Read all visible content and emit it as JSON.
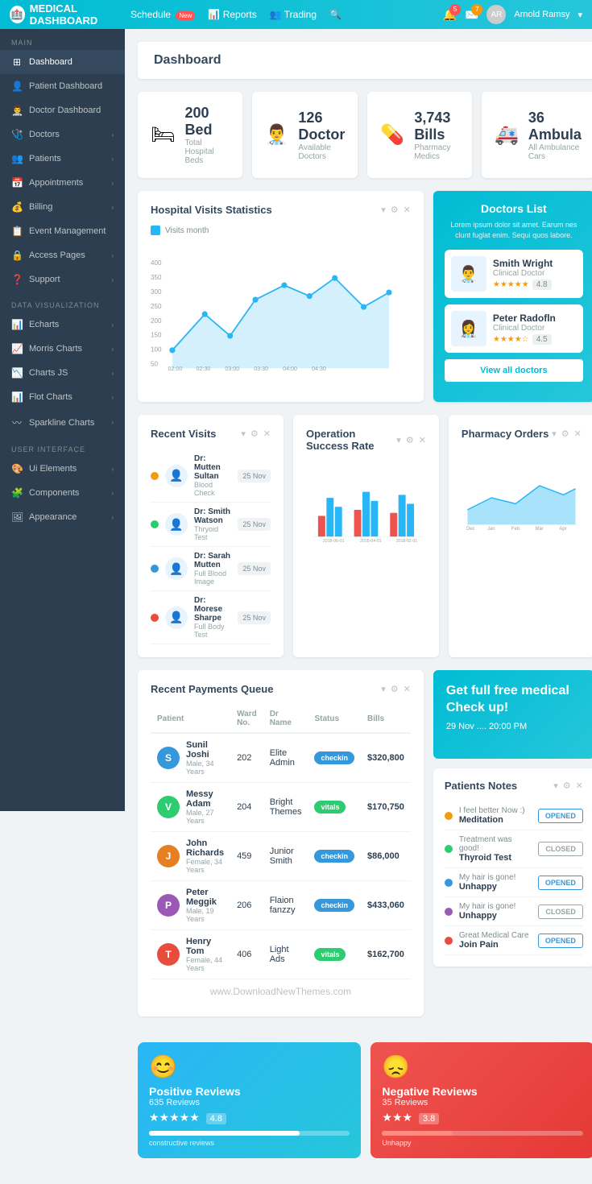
{
  "app": {
    "name": "MEDICAL DASHBOARD",
    "logo_icon": "🏥"
  },
  "topnav": {
    "schedule_label": "Schedule",
    "schedule_badge": "New",
    "reports_label": "Reports",
    "trading_label": "Trading",
    "notif_count": "5",
    "msg_count": "7",
    "user_name": "Arnold Ramsy"
  },
  "sidebar": {
    "main_title": "MAIN",
    "items_main": [
      {
        "label": "Dashboard",
        "icon": "⊞"
      },
      {
        "label": "Patient Dashboard",
        "icon": "👤"
      },
      {
        "label": "Doctor Dashboard",
        "icon": "👨‍⚕️"
      },
      {
        "label": "Doctors",
        "icon": "🩺",
        "has_arrow": true
      },
      {
        "label": "Patients",
        "icon": "👥",
        "has_arrow": true
      },
      {
        "label": "Appointments",
        "icon": "📅",
        "has_arrow": true
      },
      {
        "label": "Billing",
        "icon": "💰",
        "has_arrow": true
      },
      {
        "label": "Event Management",
        "icon": "📋"
      },
      {
        "label": "Access Pages",
        "icon": "🔒",
        "has_arrow": true
      },
      {
        "label": "Support",
        "icon": "❓",
        "has_arrow": true
      }
    ],
    "data_viz_title": "DATA VISUALIZATION",
    "items_data": [
      {
        "label": "Echarts",
        "icon": "📊",
        "has_arrow": true
      },
      {
        "label": "Morris Charts",
        "icon": "📈",
        "has_arrow": true
      },
      {
        "label": "Charts JS",
        "icon": "📉",
        "has_arrow": true
      },
      {
        "label": "Flot Charts",
        "icon": "📊",
        "has_arrow": true
      },
      {
        "label": "Sparkline Charts",
        "icon": "〰",
        "has_arrow": true
      }
    ],
    "ui_title": "USER INTERFACE",
    "items_ui": [
      {
        "label": "Ui Elements",
        "icon": "🎨",
        "has_arrow": true
      },
      {
        "label": "Components",
        "icon": "🧩",
        "has_arrow": true
      },
      {
        "label": "Appearance",
        "icon": "🖼",
        "has_arrow": true
      }
    ]
  },
  "page": {
    "title": "Dashboard"
  },
  "stats": [
    {
      "number": "200 Bed",
      "label": "Total Hospital Beds",
      "icon": "🛏"
    },
    {
      "number": "126 Doctor",
      "label": "Available Doctors",
      "icon": "👨‍⚕️"
    },
    {
      "number": "3,743 Bills",
      "label": "Pharmacy Medics",
      "icon": "💊"
    },
    {
      "number": "36 Ambula",
      "label": "All Ambulance Cars",
      "icon": "🚑"
    }
  ],
  "hospital_chart": {
    "title": "Hospital Visits Statistics",
    "legend": "Visits month",
    "x_labels": [
      "02:00",
      "02:30",
      "03:00",
      "03:30",
      "04:00",
      "04:30"
    ]
  },
  "doctors_list": {
    "title": "Doctors List",
    "description": "Lorem ipsum dolor sit amet. Earum nes clunt fuglat enim. Sequi quos labore.",
    "doctors": [
      {
        "name": "Smith Wright",
        "specialty": "Clinical Doctor",
        "rating": "4.8",
        "stars": 5
      },
      {
        "name": "Peter Radofln",
        "specialty": "Clinical Doctor",
        "rating": "4.5",
        "stars": 4
      }
    ],
    "view_all_label": "View all doctors"
  },
  "recent_visits": {
    "title": "Recent Visits",
    "visits": [
      {
        "name": "Dr: Mutten Sultan",
        "type": "Blood Check",
        "date": "25 Nov",
        "color": "#f39c12"
      },
      {
        "name": "Dr: Smith Watson",
        "type": "Thryoid Test",
        "date": "25 Nov",
        "color": "#2ecc71"
      },
      {
        "name": "Dr: Sarah Mutten",
        "type": "Full Blood Image",
        "date": "25 Nov",
        "color": "#3498db"
      },
      {
        "name": "Dr: Morese Sharpe",
        "type": "Full Body Test",
        "date": "25 Nov",
        "color": "#e74c3c"
      }
    ]
  },
  "operation_chart": {
    "title": "Operation Success Rate",
    "x_labels": [
      "2018-06-01",
      "2018-04-01",
      "2018-02-01"
    ]
  },
  "pharmacy_orders": {
    "title": "Pharmacy Orders",
    "x_labels": [
      "Dec",
      "Jan",
      "Feb",
      "Mar",
      "Apr"
    ]
  },
  "payments": {
    "title": "Recent Payments Queue",
    "columns": [
      "Patient",
      "Ward No.",
      "Dr Name",
      "Status",
      "Bills"
    ],
    "rows": [
      {
        "name": "Sunil Joshi",
        "meta": "Male, 34 Years",
        "ward": "202",
        "dr": "Elite Admin",
        "status": "checkin",
        "bills": "$320,800",
        "color": "#3498db",
        "initial": "S"
      },
      {
        "name": "Messy Adam",
        "meta": "Male, 27 Years",
        "ward": "204",
        "dr": "Bright Themes",
        "status": "vitals",
        "bills": "$170,750",
        "color": "#2ecc71",
        "initial": "V"
      },
      {
        "name": "John Richards",
        "meta": "Female, 34 Years",
        "ward": "459",
        "dr": "Junior Smith",
        "status": "checkin",
        "bills": "$86,000",
        "color": "#e67e22",
        "initial": "J"
      },
      {
        "name": "Peter Meggik",
        "meta": "Male, 19 Years",
        "ward": "206",
        "dr": "Flaion fanzzy",
        "status": "checkin",
        "bills": "$433,060",
        "color": "#9b59b6",
        "initial": "P"
      },
      {
        "name": "Henry Tom",
        "meta": "Female, 44 Years",
        "ward": "406",
        "dr": "Light Ads",
        "status": "vitals",
        "bills": "$162,700",
        "color": "#e74c3c",
        "initial": "T"
      }
    ]
  },
  "promo": {
    "title": "Get full free medical Check up!",
    "date": "29 Nov .... 20:00 PM"
  },
  "patients_notes": {
    "title": "Patients Notes",
    "notes": [
      {
        "text": "I feel better Now :)",
        "name": "Meditation",
        "status": "OPENED",
        "color": "#f39c12"
      },
      {
        "text": "Treatment was good!",
        "name": "Thyroid Test",
        "status": "CLOSED",
        "color": "#2ecc71"
      },
      {
        "text": "My hair is gone!",
        "name": "Unhappy",
        "status": "OPENED",
        "color": "#3498db"
      },
      {
        "text": "My hair is gone!",
        "name": "Unhappy",
        "status": "CLOSED",
        "color": "#9b59b6"
      },
      {
        "text": "Great Medical Care",
        "name": "Join Pain",
        "status": "OPENED",
        "color": "#e74c3c"
      }
    ]
  },
  "reviews": {
    "positive": {
      "title": "Positive Reviews",
      "count": "635 Reviews",
      "rating": "4.8",
      "stars": "★★★★★",
      "progress": 75,
      "label": "constructive reviews"
    },
    "negative": {
      "title": "Negative Reviews",
      "count": "35 Reviews",
      "rating": "3.8",
      "stars": "★★★",
      "progress": 35,
      "label": "Unhappy"
    }
  },
  "watermark": "www.DownloadNewThemes.com"
}
